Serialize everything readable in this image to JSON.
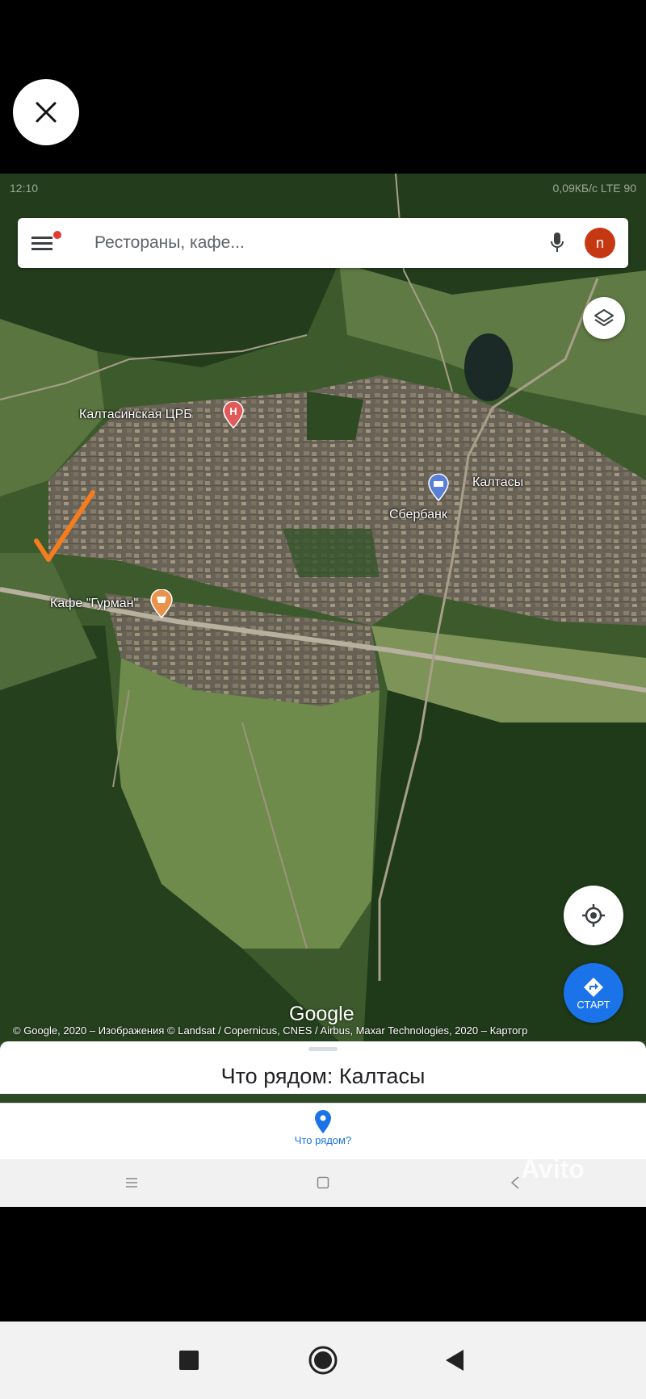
{
  "overlay": {
    "close_label": "close"
  },
  "status_bar": {
    "time": "12:10",
    "right_text": "0,09КБ/с  LTE  90"
  },
  "search": {
    "placeholder": "Рестораны, кафе...",
    "avatar_letter": "n"
  },
  "map": {
    "labels": [
      {
        "text": "Калтасинская ЦРБ"
      },
      {
        "text": "Калтасы"
      },
      {
        "text": "Сбербанк"
      },
      {
        "text": "Кафе \"Гурман\""
      }
    ],
    "logo": "Google",
    "copyright": "© Google, 2020 – Изображения © Landsat / Copernicus, CNES / Airbus, Maxar Technologies, 2020 – Картогр"
  },
  "start_button": {
    "label": "СТАРТ"
  },
  "bottom_sheet": {
    "title": "Что рядом: Калтасы"
  },
  "explore": {
    "label": "Что рядом?"
  },
  "watermark": "Avito",
  "colors": {
    "accent": "#1a73e8",
    "hospital": "#e05a5a",
    "cafe": "#e8924a",
    "check": "#f57c1f"
  }
}
